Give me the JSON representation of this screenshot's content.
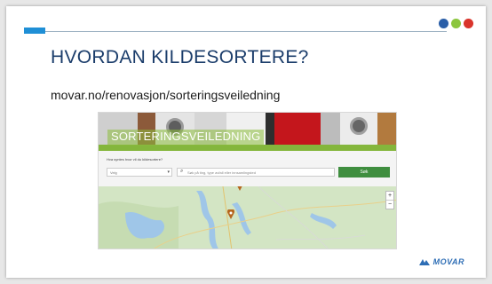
{
  "slide": {
    "title": "HVORDAN KILDESORTERE?",
    "url": "movar.no/renovasjon/sorteringsveiledning",
    "footer_logo_text": "MOVAR",
    "colors": {
      "accent": "#1f8fd6",
      "title": "#1b3d6b",
      "brand_green": "#84b63c",
      "button": "#3f8e3f"
    }
  },
  "header_logos": [
    "blue-logo-icon",
    "green-logo-icon",
    "red-logo-icon"
  ],
  "embedded_page": {
    "banner_text": "SORTERINGSVEILEDNING",
    "question": "Hva syntes hvor vil du kildesortere?",
    "select_value": "Velg",
    "search_placeholder": "Søk på ting, type avfall eller innsamlingsted",
    "search_button": "Søk",
    "zoom_in": "+",
    "zoom_out": "−"
  }
}
